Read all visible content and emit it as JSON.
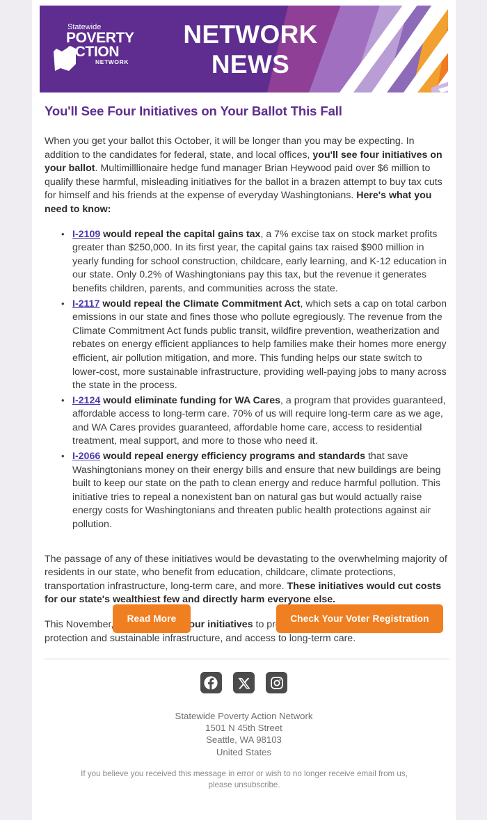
{
  "colors": {
    "brand_purple": "#5E2D8F",
    "accent_orange": "#F07F22",
    "link_purple": "#4A3AAD",
    "page_background": "#EFEDF1",
    "card_background": "#FFFFFF",
    "social_icon_background": "#4B4B4B"
  },
  "header": {
    "logo": {
      "line1": "Statewide",
      "line2": "POVERTY",
      "line3": "ACTION",
      "line4": "NETWORK",
      "alt": "Statewide Poverty Action Network logo"
    },
    "title_line1": "NETWORK",
    "title_line2": "NEWS"
  },
  "article": {
    "headline": "You'll See Four Initiatives on Your Ballot This Fall",
    "intro": {
      "part1": "When you get your ballot this October, it will be longer than you may be expecting. In addition to the candidates for federal, state, and local offices, ",
      "bold1": "you'll see four initiatives on your ballot",
      "part2": ". Multimilllionaire hedge fund manager Brian Heywood paid over $6 million to qualify these harmful, misleading initiatives for the ballot in a brazen attempt to buy tax cuts for himself and his friends at the expense of everyday Washingtonians. ",
      "bold2": "Here's what you need to know:"
    },
    "bullets": [
      {
        "link": "I-2109",
        "bold": " would repeal the capital gains tax",
        "rest": ", a 7% excise tax on stock market profits greater than $250,000. In its first year, the capital gains tax raised $900 million in yearly funding for school construction, childcare, early learning, and K-12 education in our state. Only 0.2% of Washingtonians pay this tax, but the revenue it generates benefits children, parents, and communities across the state."
      },
      {
        "link": "I-2117",
        "bold": " would repeal the Climate Commitment Act",
        "rest": ", which sets a cap on total carbon emissions in our state and fines those who pollute egregiously. The revenue from the Climate Commitment Act funds public transit, wildfire prevention, weatherization and rebates on energy efficient appliances to help families make their homes more energy efficient, air pollution mitigation, and more. This funding helps our state switch to lower-cost, more sustainable infrastructure, providing well-paying jobs to many across the state in the process."
      },
      {
        "link": "I-2124",
        "bold": " would eliminate funding for WA Cares",
        "rest": ", a program that provides guaranteed, affordable access to long-term care. 70% of us will require long-term care as we age, and WA Cares provides guaranteed, affordable home care, access to residential treatment, meal support, and more to those who need it."
      },
      {
        "link": "I-2066",
        "bold": " would repeal energy efficiency programs and standards",
        "rest": " that save Washingtonians money on their energy bills and ensure that new buildings are being built to keep our state on the path to clean energy and reduce harmful pollution. This initiative tries to repeal a nonexistent ban on natural gas but would actually raise energy costs for Washingtonians and threaten public health protections against air pollution."
      }
    ],
    "closing1": {
      "part1": "The passage of any of these initiatives would be devastating to the overwhelming majority of residents in our state, who benefit from education, childcare, climate protections, transportation infrastructure, long-term care, and more. ",
      "bold1": "These initiatives would cut costs for our state's wealthiest few and directly harm everyone else."
    },
    "closing2": {
      "part1": "This November, ",
      "bold1": "vote NO on all four initiatives",
      "part2": " to protect funding for education, climate protection and sustainable infrastructure, and access to long-term care."
    }
  },
  "cta": {
    "read_more_label": "Read More",
    "voter_registration_label": "Check Your Voter Registration"
  },
  "footer": {
    "social": [
      {
        "name": "facebook-icon",
        "label": "Facebook"
      },
      {
        "name": "x-twitter-icon",
        "label": "X"
      },
      {
        "name": "instagram-icon",
        "label": "Instagram"
      }
    ],
    "address": {
      "org": "Statewide Poverty Action Network",
      "street": "1501 N 45th Street",
      "city_state_zip": "Seattle, WA 98103",
      "country": "United States"
    },
    "unsubscribe_text": "If you believe you received this message in error or wish to no longer receive email from us, please unsubscribe."
  }
}
